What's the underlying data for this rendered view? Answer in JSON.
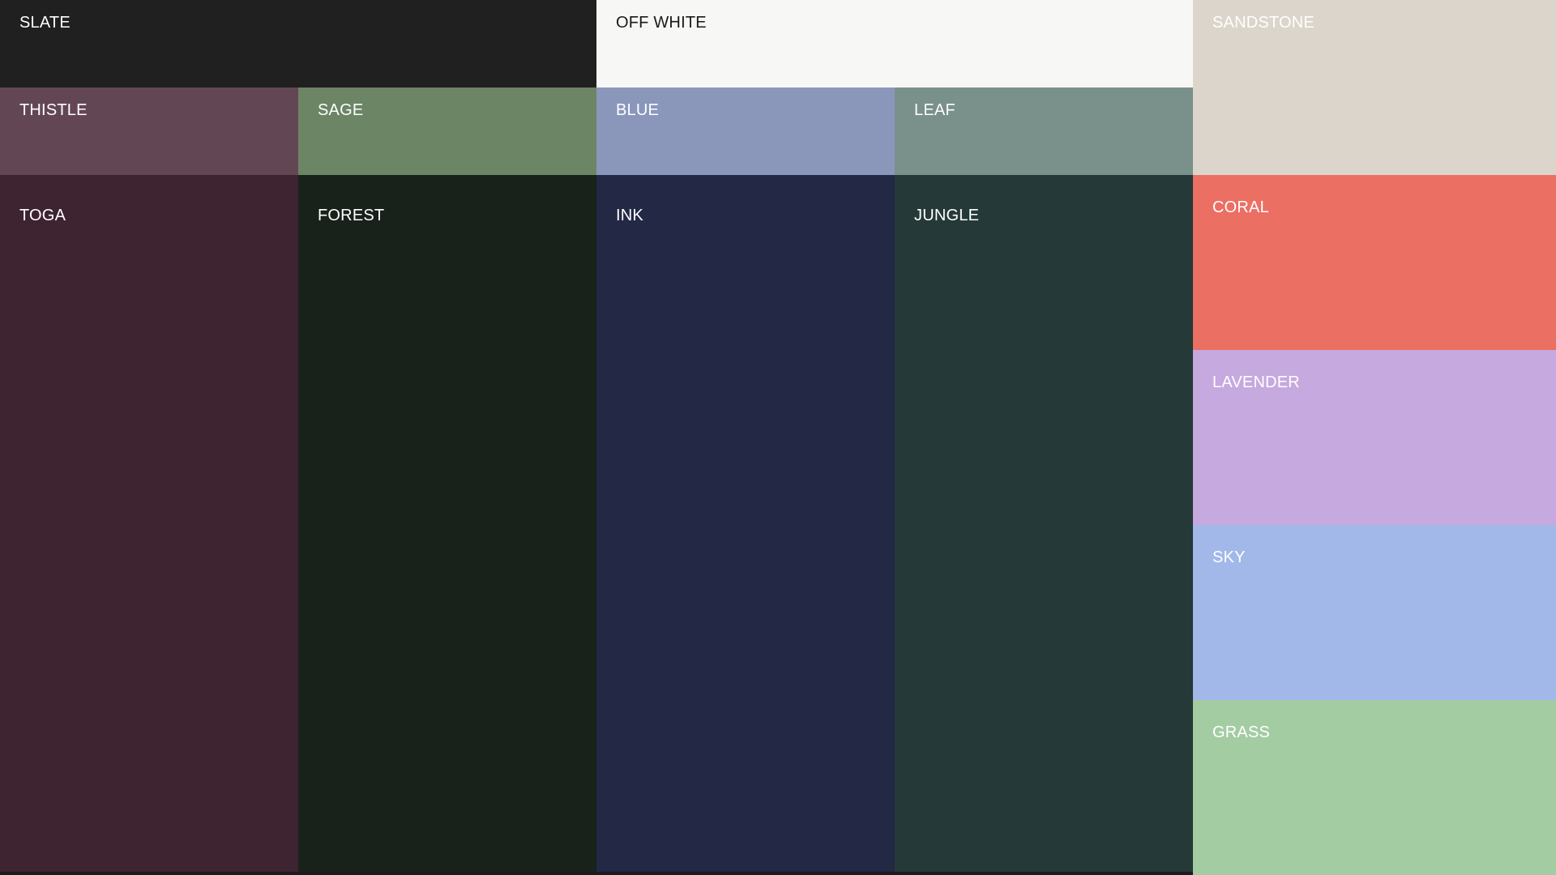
{
  "swatches": {
    "slate": {
      "label": "SLATE",
      "color": "#202020",
      "text_color": "#ffffff"
    },
    "offwhite": {
      "label": "OFF WHITE",
      "color": "#f7f7f5",
      "text_color": "#1a1a1a"
    },
    "sandstone": {
      "label": "SANDSTONE",
      "color": "#dcd5cb",
      "text_color": "#ffffff"
    },
    "thistle": {
      "label": "THISTLE",
      "color": "#634654",
      "text_color": "#ffffff"
    },
    "sage": {
      "label": "SAGE",
      "color": "#6b8565",
      "text_color": "#ffffff"
    },
    "blue": {
      "label": "BLUE",
      "color": "#8a97bb",
      "text_color": "#ffffff"
    },
    "leaf": {
      "label": "LEAF",
      "color": "#7a908b",
      "text_color": "#ffffff"
    },
    "toga": {
      "label": "TOGA",
      "color": "#3e2331",
      "text_color": "#ffffff"
    },
    "forest": {
      "label": "FOREST",
      "color": "#19211b",
      "text_color": "#ffffff"
    },
    "ink": {
      "label": "INK",
      "color": "#232845",
      "text_color": "#ffffff"
    },
    "jungle": {
      "label": "JUNGLE",
      "color": "#243938",
      "text_color": "#ffffff"
    },
    "coral": {
      "label": "CORAL",
      "color": "#ec6f63",
      "text_color": "#ffffff"
    },
    "lavender": {
      "label": "LAVENDER",
      "color": "#c6a9df",
      "text_color": "#ffffff"
    },
    "sky": {
      "label": "SKY",
      "color": "#a2b8e9",
      "text_color": "#ffffff"
    },
    "grass": {
      "label": "GRASS",
      "color": "#a4cca3",
      "text_color": "#ffffff"
    }
  }
}
